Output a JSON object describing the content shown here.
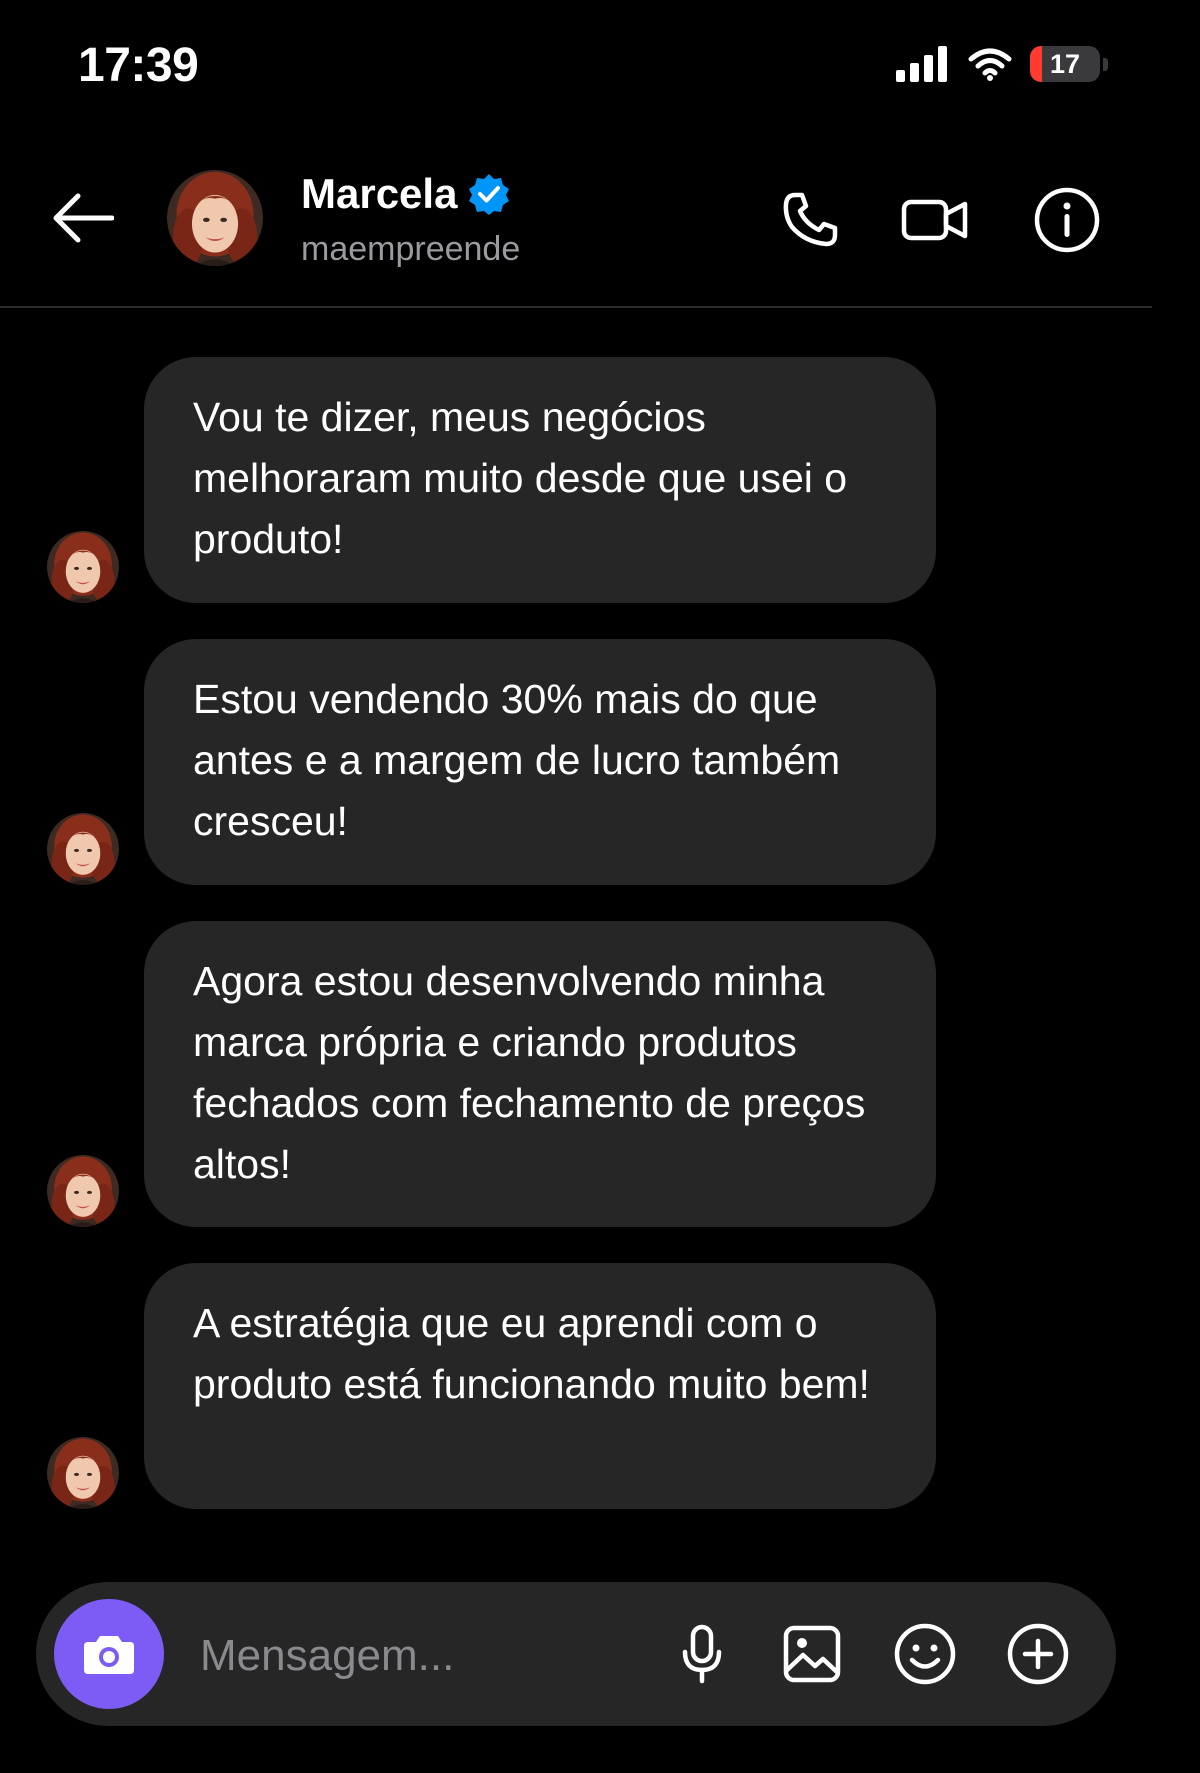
{
  "status_bar": {
    "time": "17:39",
    "battery_level": "17",
    "battery_fraction": 0.17
  },
  "header": {
    "contact_name": "Marcela",
    "contact_handle": "maempreende",
    "verified": true,
    "icons": [
      "back-arrow-icon",
      "phone-icon",
      "video-camera-icon",
      "info-icon"
    ]
  },
  "messages": [
    {
      "text": "Vou te dizer, meus negócios melhoraram muito desde que usei o produto!"
    },
    {
      "text": "Estou vendendo 30% mais do que antes e a margem de lucro também cresceu!"
    },
    {
      "text": "Agora estou desenvolvendo minha marca própria e criando produtos fechados com fechamento de preços altos!"
    },
    {
      "text": "A estratégia que eu aprendi com o produto está funcionando muito bem!"
    }
  ],
  "composer": {
    "placeholder": "Mensagem...",
    "value": "",
    "icons": [
      "camera-icon",
      "microphone-icon",
      "gallery-icon",
      "emoji-icon",
      "plus-icon"
    ]
  },
  "colors": {
    "background": "#000000",
    "bubble": "#262626",
    "accent_camera": "#7c5cf5",
    "verified_badge": "#0095f6",
    "handle_text": "#9a9a9f",
    "battery_low": "#ff3b30"
  }
}
